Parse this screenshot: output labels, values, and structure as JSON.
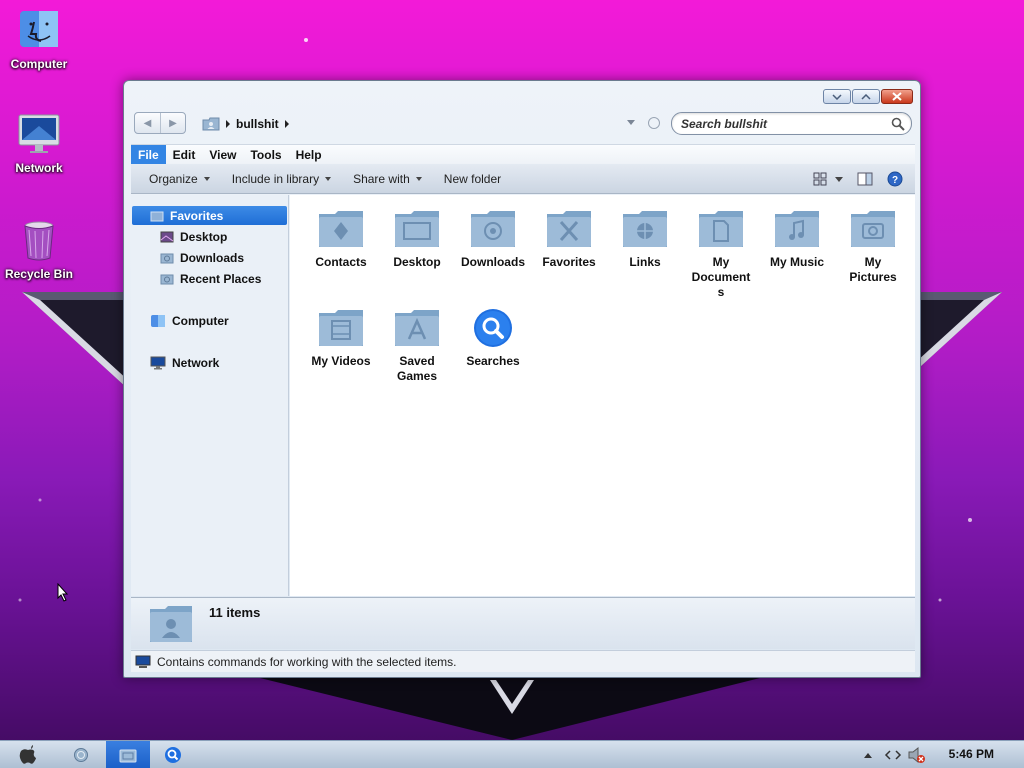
{
  "desktop": {
    "icons": [
      {
        "label": "Computer",
        "icon": "finder-icon"
      },
      {
        "label": "Network",
        "icon": "monitor-icon"
      },
      {
        "label": "Recycle Bin",
        "icon": "trash-icon"
      }
    ]
  },
  "window": {
    "breadcrumb": "bullshit",
    "search_placeholder": "Search bullshit",
    "menu": [
      "File",
      "Edit",
      "View",
      "Tools",
      "Help"
    ],
    "toolbar": {
      "organize": "Organize",
      "include_in_library": "Include in library",
      "share_with": "Share with",
      "new_folder": "New folder"
    },
    "nav": {
      "favorites": "Favorites",
      "desktop": "Desktop",
      "downloads": "Downloads",
      "recent_places": "Recent Places",
      "computer": "Computer",
      "network": "Network"
    },
    "folders": [
      {
        "line1": "Contacts",
        "line2": "",
        "line3": ""
      },
      {
        "line1": "Desktop",
        "line2": "",
        "line3": ""
      },
      {
        "line1": "Downloads",
        "line2": "",
        "line3": ""
      },
      {
        "line1": "Favorites",
        "line2": "",
        "line3": ""
      },
      {
        "line1": "Links",
        "line2": "",
        "line3": ""
      },
      {
        "line1": "My",
        "line2": "Document",
        "line3": "s"
      },
      {
        "line1": "My Music",
        "line2": "",
        "line3": ""
      },
      {
        "line1": "My",
        "line2": "Pictures",
        "line3": ""
      },
      {
        "line1": "My Videos",
        "line2": "",
        "line3": ""
      },
      {
        "line1": "Saved",
        "line2": "Games",
        "line3": ""
      },
      {
        "line1": "Searches",
        "line2": "",
        "line3": ""
      }
    ],
    "details": {
      "count": "11 items"
    },
    "status": "Contains commands for working with the selected items."
  },
  "taskbar": {
    "clock": "5:46 PM"
  },
  "colors": {
    "accent": "#2f7fe2",
    "folder": "#8fb1cf"
  }
}
